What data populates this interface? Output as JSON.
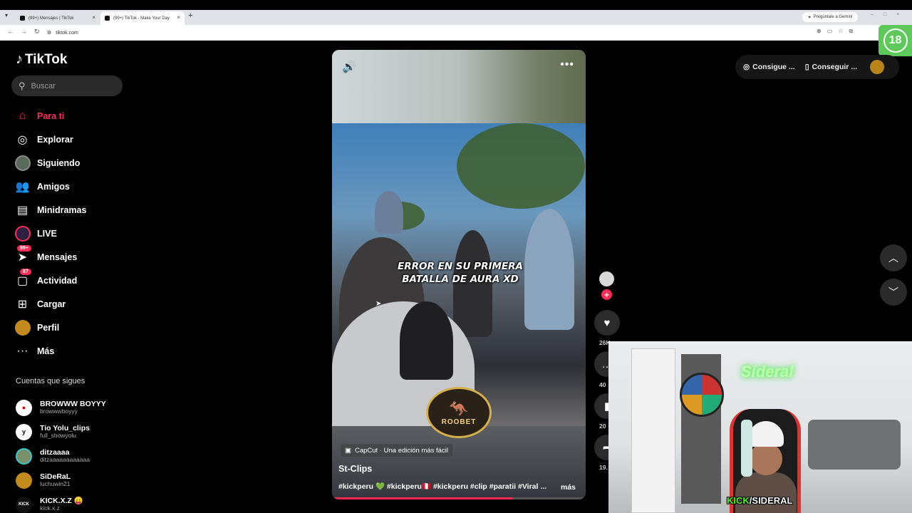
{
  "browser": {
    "tabs": [
      {
        "title": "(99+) Mensajes | TikTok",
        "active": false
      },
      {
        "title": "(99+) TikTok - Make Your Day",
        "active": true
      }
    ],
    "gemini_label": "Pregúntale a Gemini",
    "url": "tiktok.com",
    "badge18": "18"
  },
  "app": {
    "name": "TikTok"
  },
  "search": {
    "placeholder": "Buscar"
  },
  "nav": {
    "items": [
      {
        "label": "Para ti",
        "icon": "home-icon",
        "active": true
      },
      {
        "label": "Explorar",
        "icon": "compass-icon"
      },
      {
        "label": "Siguiendo",
        "icon": "following-avatar-icon"
      },
      {
        "label": "Amigos",
        "icon": "friends-icon"
      },
      {
        "label": "Minidramas",
        "icon": "film-icon"
      },
      {
        "label": "LIVE",
        "icon": "live-icon"
      },
      {
        "label": "Mensajes",
        "icon": "messages-icon",
        "badge": "99+"
      },
      {
        "label": "Actividad",
        "icon": "activity-icon",
        "badge": "87"
      },
      {
        "label": "Cargar",
        "icon": "upload-icon"
      },
      {
        "label": "Perfil",
        "icon": "profile-icon"
      },
      {
        "label": "Más",
        "icon": "more-icon"
      }
    ]
  },
  "following": {
    "title": "Cuentas que sigues",
    "accounts": [
      {
        "name": "BROWWW BOYYY",
        "handle": "browwwboyyy",
        "color": "#ffffff"
      },
      {
        "name": "Tio Yolu_clips",
        "handle": "full_showyolu",
        "color": "#ffffff"
      },
      {
        "name": "ditzaaaa",
        "handle": "ditzaaaaaaaaaaaa",
        "color": "#7b8f6a"
      },
      {
        "name": "SiDeRaL",
        "handle": "luchuwin21",
        "color": "#c38a1e"
      },
      {
        "name": "KICK.X.Z 😛",
        "handle": "kick.x.z",
        "color": "#111111"
      }
    ]
  },
  "video": {
    "overlay_line1": "ERROR EN SU PRIMERA",
    "overlay_line2": "BATALLA DE AURA XD",
    "sponsor": "ROOBET",
    "capcut": "CapCut · Una edición más fácil",
    "author": "St-Clips",
    "description": "#kickperu 💚 #kickperu🇵🇪 #kickperu #clip #paratii #Viral ...",
    "more": "más",
    "progress": 0.71
  },
  "actions": {
    "likes": "26K",
    "comments": "40",
    "saves": "20",
    "shares": "19."
  },
  "topright": {
    "btn1": "Consigue ...",
    "btn2": "Conseguir ..."
  },
  "webcam": {
    "neon": "Sideral",
    "kick": "KICK",
    "channel": "/SIDERAL"
  }
}
